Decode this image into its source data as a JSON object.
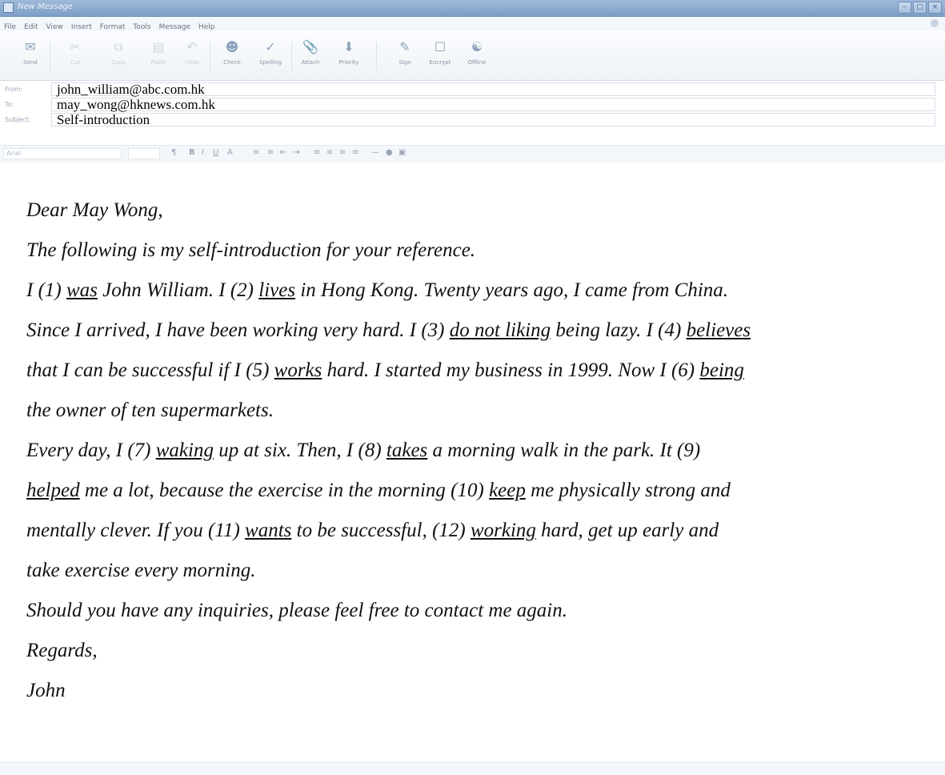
{
  "window": {
    "title": "New Message"
  },
  "menu": [
    "File",
    "Edit",
    "View",
    "Insert",
    "Format",
    "Tools",
    "Message",
    "Help"
  ],
  "toolbar": [
    {
      "label": "Send",
      "enabled": true
    },
    {
      "label": "Cut",
      "enabled": false
    },
    {
      "label": "Copy",
      "enabled": false
    },
    {
      "label": "Paste",
      "enabled": false
    },
    {
      "label": "Undo",
      "enabled": false
    },
    {
      "label": "Check",
      "enabled": true
    },
    {
      "label": "Spelling",
      "enabled": true
    },
    {
      "label": "Attach",
      "enabled": true
    },
    {
      "label": "Priority",
      "enabled": true
    },
    {
      "label": "Sign",
      "enabled": true
    },
    {
      "label": "Encrypt",
      "enabled": true
    },
    {
      "label": "Offline",
      "enabled": true
    }
  ],
  "header": {
    "from_label": "From:",
    "from_value": "john_william@abc.com.hk",
    "to_label": "To:",
    "to_value": "may_wong@hknews.com.hk",
    "subject_label": "Subject:",
    "subject_value": "Self-introduction"
  },
  "format": {
    "font": "Arial"
  },
  "message": {
    "greeting": "Dear May Wong,",
    "intro": "The following is my self-introduction for your reference.",
    "p1_l1": [
      "I (1) ",
      "was",
      " John William. I (2) ",
      "lives",
      " in Hong Kong. Twenty years ago, I came from China."
    ],
    "p1_l2": [
      "Since I arrived, I have been working very hard. I (3) ",
      "do not liking",
      " being lazy. I (4) ",
      "believes"
    ],
    "p1_l3": [
      "that I can be successful if I (5) ",
      "works",
      " hard. I started my business in 1999. Now I (6) ",
      "being"
    ],
    "p1_l4": [
      "the owner of ten supermarkets."
    ],
    "p2_l1": [
      "Every day, I (7) ",
      "waking",
      " up at six. Then, I (8) ",
      "takes",
      " a morning walk in the park. It (9)"
    ],
    "p2_l2": [
      "",
      "helped",
      " me a lot, because the exercise in the morning (10) ",
      "keep",
      " me physically strong and"
    ],
    "p2_l3": [
      "mentally clever. If you (11) ",
      "wants",
      " to be successful, (12) ",
      "working",
      " hard, get up early and"
    ],
    "p2_l4": [
      "take exercise every morning."
    ],
    "closing": "Should you have any inquiries, please feel free to contact me again.",
    "regards": "Regards,",
    "signature": "John"
  }
}
